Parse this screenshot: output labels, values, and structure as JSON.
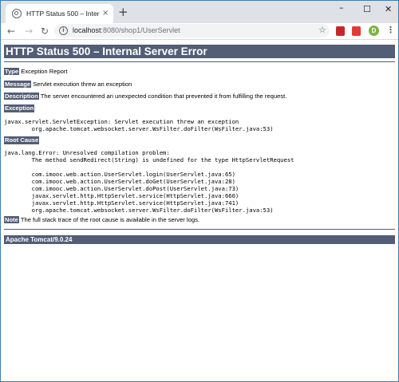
{
  "browser": {
    "tab_title": "HTTP Status 500 – Internal Server Error",
    "tab_close": "×",
    "new_tab": "+",
    "url_host": "localhost",
    "url_path": ":8080/shop1/UserServlet",
    "window_controls": {
      "minimize": "–",
      "maximize": "☐",
      "close": "✕"
    },
    "nav": {
      "back": "←",
      "forward": "→",
      "reload": "↻"
    },
    "bookmark_star": "☆",
    "info_icon": "i",
    "menu": "⋮",
    "profile_initial": "D"
  },
  "page": {
    "heading": "HTTP Status 500 – Internal Server Error",
    "type_label": "Type",
    "type_value": " Exception Report",
    "message_label": "Message",
    "message_value": " Servlet execution threw an exception",
    "description_label": "Description",
    "description_value": " The server encountered an unexpected condition that prevented it from fulfilling the request.",
    "exception_heading": "Exception",
    "exception_trace": "javax.servlet.ServletException: Servlet execution threw an exception\n\torg.apache.tomcat.websocket.server.WsFilter.doFilter(WsFilter.java:53)",
    "root_cause_heading": "Root Cause",
    "root_cause_trace": "java.lang.Error: Unresolved compilation problem:\n\tThe method sendRedirect(String) is undefined for the type HttpServletRequest\n\n\tcom.imooc.web.action.UserServlet.login(UserServlet.java:65)\n\tcom.imooc.web.action.UserServlet.doGet(UserServlet.java:28)\n\tcom.imooc.web.action.UserServlet.doPost(UserServlet.java:73)\n\tjavax.servlet.http.HttpServlet.service(HttpServlet.java:660)\n\tjavax.servlet.http.HttpServlet.service(HttpServlet.java:741)\n\torg.apache.tomcat.websocket.server.WsFilter.doFilter(WsFilter.java:53)",
    "note_label": "Note",
    "note_value": " The full stack trace of the root cause is available in the server logs.",
    "footer": "Apache Tomcat/9.0.24"
  },
  "colors": {
    "tomcat_header": "#525d76",
    "titlebar": "#dee1e6",
    "window_border": "#3c7fb1"
  }
}
